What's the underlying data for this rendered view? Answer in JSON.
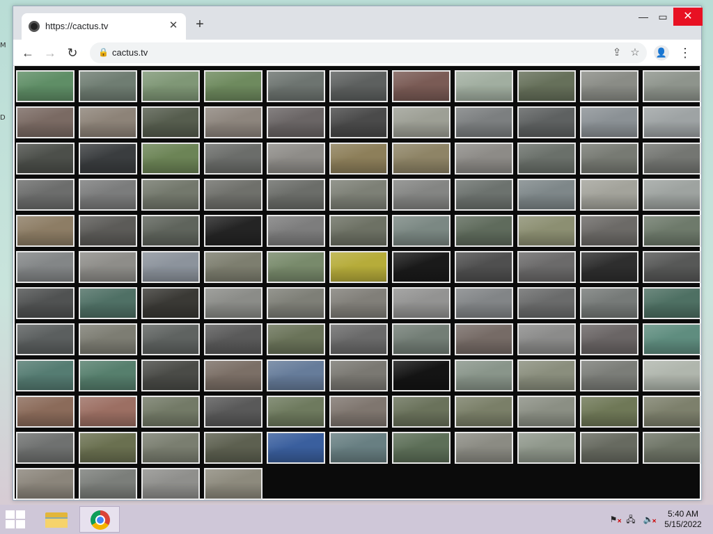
{
  "desktop": {
    "glyph_top": "M",
    "glyph_mid": "D"
  },
  "window": {
    "minimize_icon": "—",
    "maximize_icon": "▭",
    "close_icon": "✕"
  },
  "tab": {
    "title": "https://cactus.tv",
    "close_icon": "✕",
    "favicon": "cactus-favicon-icon"
  },
  "new_tab_icon": "+",
  "toolbar": {
    "back_icon": "←",
    "forward_icon": "→",
    "reload_icon": "↻",
    "url": "cactus.tv",
    "lock_icon": "🔒",
    "share_icon": "⇪",
    "star_icon": "☆",
    "profile_icon": "👤",
    "menu_icon": "⋮"
  },
  "camera_grid": {
    "columns": 11,
    "cameras": [
      "#5f8e66",
      "#6f7d72",
      "#7f9776",
      "#6e8a5e",
      "#6d7470",
      "#5d605f",
      "#7a5b55",
      "#a1aea0",
      "#66705a",
      "#8a8c86",
      "#8e948c",
      "#7a6a63",
      "#8d8378",
      "#565d4e",
      "#8d857d",
      "#6a6565",
      "#4a4a4a",
      "#9d9f95",
      "#7c7f80",
      "#5e6161",
      "#8b9195",
      "#9ea3a4",
      "#4c4f4a",
      "#3a3d3f",
      "#6c8456",
      "#6b6d6a",
      "#8e8c88",
      "#8d7f5a",
      "#8e8466",
      "#8d8b87",
      "#6a706a",
      "#777a73",
      "#747672",
      "#6c6d6c",
      "#7b7c7c",
      "#73786c",
      "#6f706b",
      "#6b6d69",
      "#7d8076",
      "#848583",
      "#6c726e",
      "#7e8789",
      "#a3a39b",
      "#9ea3a0",
      "#8d7d65",
      "#5c5b58",
      "#5f645c",
      "#242424",
      "#7d7d7d",
      "#6d7164",
      "#7b8883",
      "#5f6b5c",
      "#8c8f72",
      "#6c6a67",
      "#6e7a6b",
      "#838687",
      "#8e8d89",
      "#8c939c",
      "#7d7e6f",
      "#788a6b",
      "#b6ac3a",
      "#1a1a1a",
      "#4f4f4f",
      "#6b6a6a",
      "#2e2e2e",
      "#575857",
      "#505252",
      "#4f7065",
      "#3a3935",
      "#8b8c88",
      "#7e7f77",
      "#817f79",
      "#939392",
      "#828587",
      "#6a6b6b",
      "#767a78",
      "#4e7063",
      "#5b5f5f",
      "#7d7d73",
      "#5f6361",
      "#5a5a5a",
      "#6a7359",
      "#6a6a6a",
      "#737e76",
      "#766b66",
      "#8b8b8a",
      "#6a6565",
      "#5f8d7f",
      "#557c72",
      "#567f6d",
      "#4a4b47",
      "#7b6f66",
      "#667c9a",
      "#7a7872",
      "#141414",
      "#89958a",
      "#8a8e7d",
      "#7b7d78",
      "#b0b6ad",
      "#8b6b5a",
      "#9c6f63",
      "#737a67",
      "#595959",
      "#6e7a5e",
      "#7f766f",
      "#6a725b",
      "#7a7f68",
      "#8b8f84",
      "#6f7857",
      "#7d806c",
      "#6f7170",
      "#6a7050",
      "#7a7e70",
      "#5d6050",
      "#3a5f9e",
      "#687f82",
      "#5d6f58",
      "#8b8b83",
      "#8f978b",
      "#676a60",
      "#6f7567",
      "#8b857b",
      "#7b7e7a",
      "#8f8f8c",
      "#8d8a7d"
    ]
  },
  "taskbar": {
    "start_icon": "windows-start-icon",
    "explorer_icon": "file-explorer-icon",
    "chrome_icon": "chrome-icon",
    "tray_flag_icon": "⚑",
    "tray_network_icon": "🖧",
    "tray_volume_icon": "🔈",
    "tray_x": "✕",
    "time": "5:40 AM",
    "date": "5/15/2022"
  }
}
